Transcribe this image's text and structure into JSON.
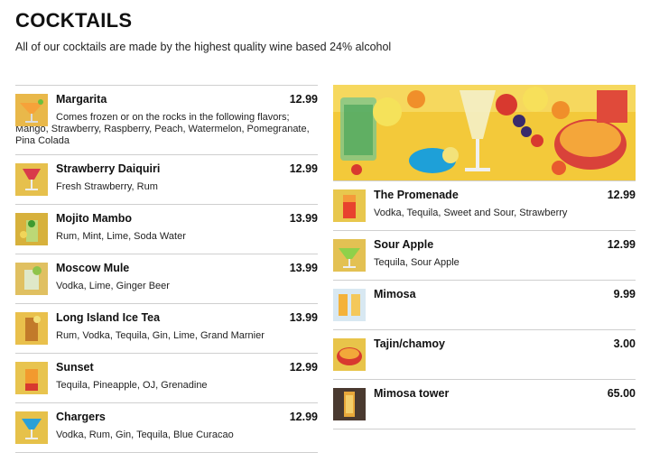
{
  "header": {
    "title": "COCKTAILS",
    "subtitle": "All of our cocktails are made by the highest quality wine based 24% alcohol"
  },
  "left_items": [
    {
      "name": "Margarita",
      "price": "12.99",
      "description": "Comes frozen or on the rocks in the following flavors; Mango, Strawberry, Raspberry, Peach, Watermelon, Pomegranate, Pina Colada",
      "thumb": "margarita-icon"
    },
    {
      "name": "Strawberry Daiquiri",
      "price": "12.99",
      "description": "Fresh Strawberry, Rum",
      "thumb": "strawberry-daiquiri-icon"
    },
    {
      "name": "Mojito Mambo",
      "price": "13.99",
      "description": "Rum, Mint, Lime, Soda Water",
      "thumb": "mojito-icon"
    },
    {
      "name": "Moscow Mule",
      "price": "13.99",
      "description": "Vodka, Lime, Ginger Beer",
      "thumb": "moscow-mule-icon"
    },
    {
      "name": "Long Island Ice Tea",
      "price": "13.99",
      "description": "Rum, Vodka, Tequila, Gin, Lime, Grand Marnier",
      "thumb": "long-island-icon"
    },
    {
      "name": "Sunset",
      "price": "12.99",
      "description": "Tequila, Pineapple, OJ, Grenadine",
      "thumb": "sunset-icon"
    },
    {
      "name": "Chargers",
      "price": "12.99",
      "description": "Vodka, Rum, Gin, Tequila, Blue Curacao",
      "thumb": "chargers-icon"
    }
  ],
  "right_items": [
    {
      "name": "The Promenade",
      "price": "12.99",
      "description": "Vodka, Tequila, Sweet and Sour, Strawberry",
      "thumb": "promenade-icon"
    },
    {
      "name": "Sour Apple",
      "price": "12.99",
      "description": "Tequila, Sour Apple",
      "thumb": "sour-apple-icon"
    },
    {
      "name": "Mimosa",
      "price": "9.99",
      "description": "",
      "thumb": "mimosa-icon"
    },
    {
      "name": "Tajin/chamoy",
      "price": "3.00",
      "description": "",
      "thumb": "tajin-icon"
    },
    {
      "name": "Mimosa tower",
      "price": "65.00",
      "description": "",
      "thumb": "mimosa-tower-icon"
    }
  ],
  "colors": {
    "rule": "#cfcfcf",
    "banner_bg": "#f3c93a",
    "text": "#111111"
  }
}
